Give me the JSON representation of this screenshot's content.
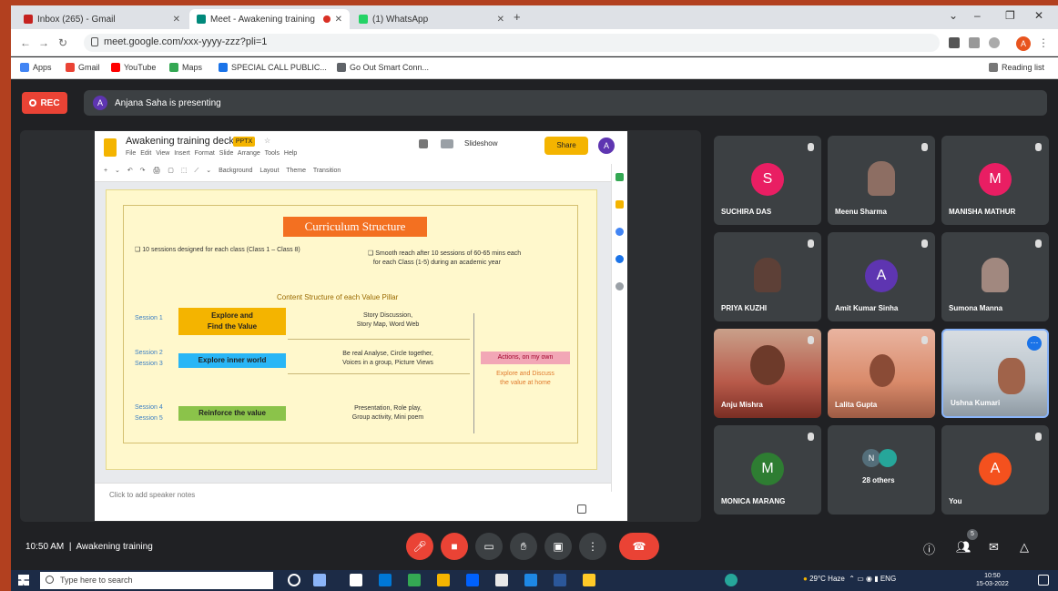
{
  "browser": {
    "tabs": [
      {
        "label": "Inbox (265) - Gmail",
        "favicon_color": "#c5221f",
        "active": false
      },
      {
        "label": "Meet - Awakening training",
        "favicon_color": "#00897b",
        "active": true
      },
      {
        "label": "(1) WhatsApp",
        "favicon_color": "#25d366",
        "active": false
      }
    ],
    "url": "meet.google.com/xxx-yyyy-zzz?pli=1",
    "bookmarks": [
      {
        "label": "Apps",
        "color": "#4285f4"
      },
      {
        "label": "Gmail",
        "color": "#ea4335"
      },
      {
        "label": "YouTube",
        "color": "#ff0000"
      },
      {
        "label": "Maps",
        "color": "#34a853"
      },
      {
        "label": "SPECIAL CALL PUBLIC...",
        "color": "#1a73e8"
      },
      {
        "label": "Go Out Smart Conn...",
        "color": "#5f6368"
      }
    ],
    "reading_list": "Reading list",
    "profile_initial": "A"
  },
  "meet": {
    "rec_label": "REC",
    "presenter_initial": "A",
    "presenting_text": "Anjana Saha is presenting",
    "time": "10:50 AM",
    "meeting_name": "Awakening training",
    "people_count": "5"
  },
  "slides_app": {
    "doc_title": "Awakening training deck",
    "badge": "PPTX",
    "menu": "File Edit View Insert Format Slide Arrange Tools Help",
    "toolbar": "Background Layout Theme Transition",
    "slideshow_label": "Slideshow",
    "present_label": "Share",
    "account_initial": "A",
    "speaker_notes": "Click to add speaker notes"
  },
  "slide": {
    "title": "Curriculum Structure",
    "bullet_left": "10 sessions designed for each class (Class 1 – Class 8)",
    "bullet_right_1": "Smooth reach after 10 sessions of 60-65 mins each",
    "bullet_right_2": "for each Class (1-5) during an academic year",
    "content_heading": "Content Structure of each Value Pillar",
    "rows": [
      {
        "sessions": [
          "Session 1"
        ],
        "value": "Explore and Find the Value",
        "value_lines": [
          "Explore and",
          "Find the Value"
        ],
        "desc": [
          "Story Discussion,",
          "Story Map, Word Web"
        ],
        "color": "#f4b400"
      },
      {
        "sessions": [
          "Session 2",
          "Session 3"
        ],
        "value": "Explore inner world",
        "value_lines": [
          "Explore inner world"
        ],
        "desc": [
          "Be real Analyse, Circle together,",
          "Voices in a group, Picture Views"
        ],
        "color": "#29b6f6"
      },
      {
        "sessions": [
          "Session 4",
          "Session 5"
        ],
        "value": "Reinforce the value",
        "value_lines": [
          "Reinforce the value"
        ],
        "desc": [
          "Presentation, Role play,",
          "Group activity, Mini poem"
        ],
        "color": "#8bc34a"
      }
    ],
    "action_title": "Actions, on my own",
    "action_desc": [
      "Explore and Discuss",
      "the value at home"
    ]
  },
  "participants": [
    {
      "name": "SUCHIRA DAS",
      "type": "avatar",
      "initial": "S",
      "color": "#e91e63"
    },
    {
      "name": "Meenu Sharma",
      "type": "photo",
      "color": "#8d6e63"
    },
    {
      "name": "MANISHA MATHUR",
      "type": "avatar",
      "initial": "M",
      "color": "#e91e63"
    },
    {
      "name": "PRIYA KUZHI",
      "type": "photo",
      "color": "#5d4037"
    },
    {
      "name": "Amit Kumar Sinha",
      "type": "avatar",
      "initial": "A",
      "color": "#5e35b1"
    },
    {
      "name": "Sumona Manna",
      "type": "photo",
      "color": "#a1887f"
    },
    {
      "name": "Anju Mishra",
      "type": "video",
      "color": "#b85a4a"
    },
    {
      "name": "Lalita Gupta",
      "type": "video",
      "color": "#d98a6a"
    },
    {
      "name": "Ushna Kumari",
      "type": "video",
      "color": "#b9c4cc"
    },
    {
      "name": "MONICA MARANG",
      "type": "avatar",
      "initial": "M",
      "color": "#2e7d32"
    },
    {
      "name": "28 others",
      "type": "others",
      "initial": "N",
      "color": "#546e7a"
    },
    {
      "name": "You",
      "type": "avatar",
      "initial": "A",
      "color": "#f4511e"
    }
  ],
  "taskbar": {
    "search_placeholder": "Type here to search",
    "weather": "29°C Haze",
    "time": "10:50",
    "date": "15-03-2022"
  }
}
